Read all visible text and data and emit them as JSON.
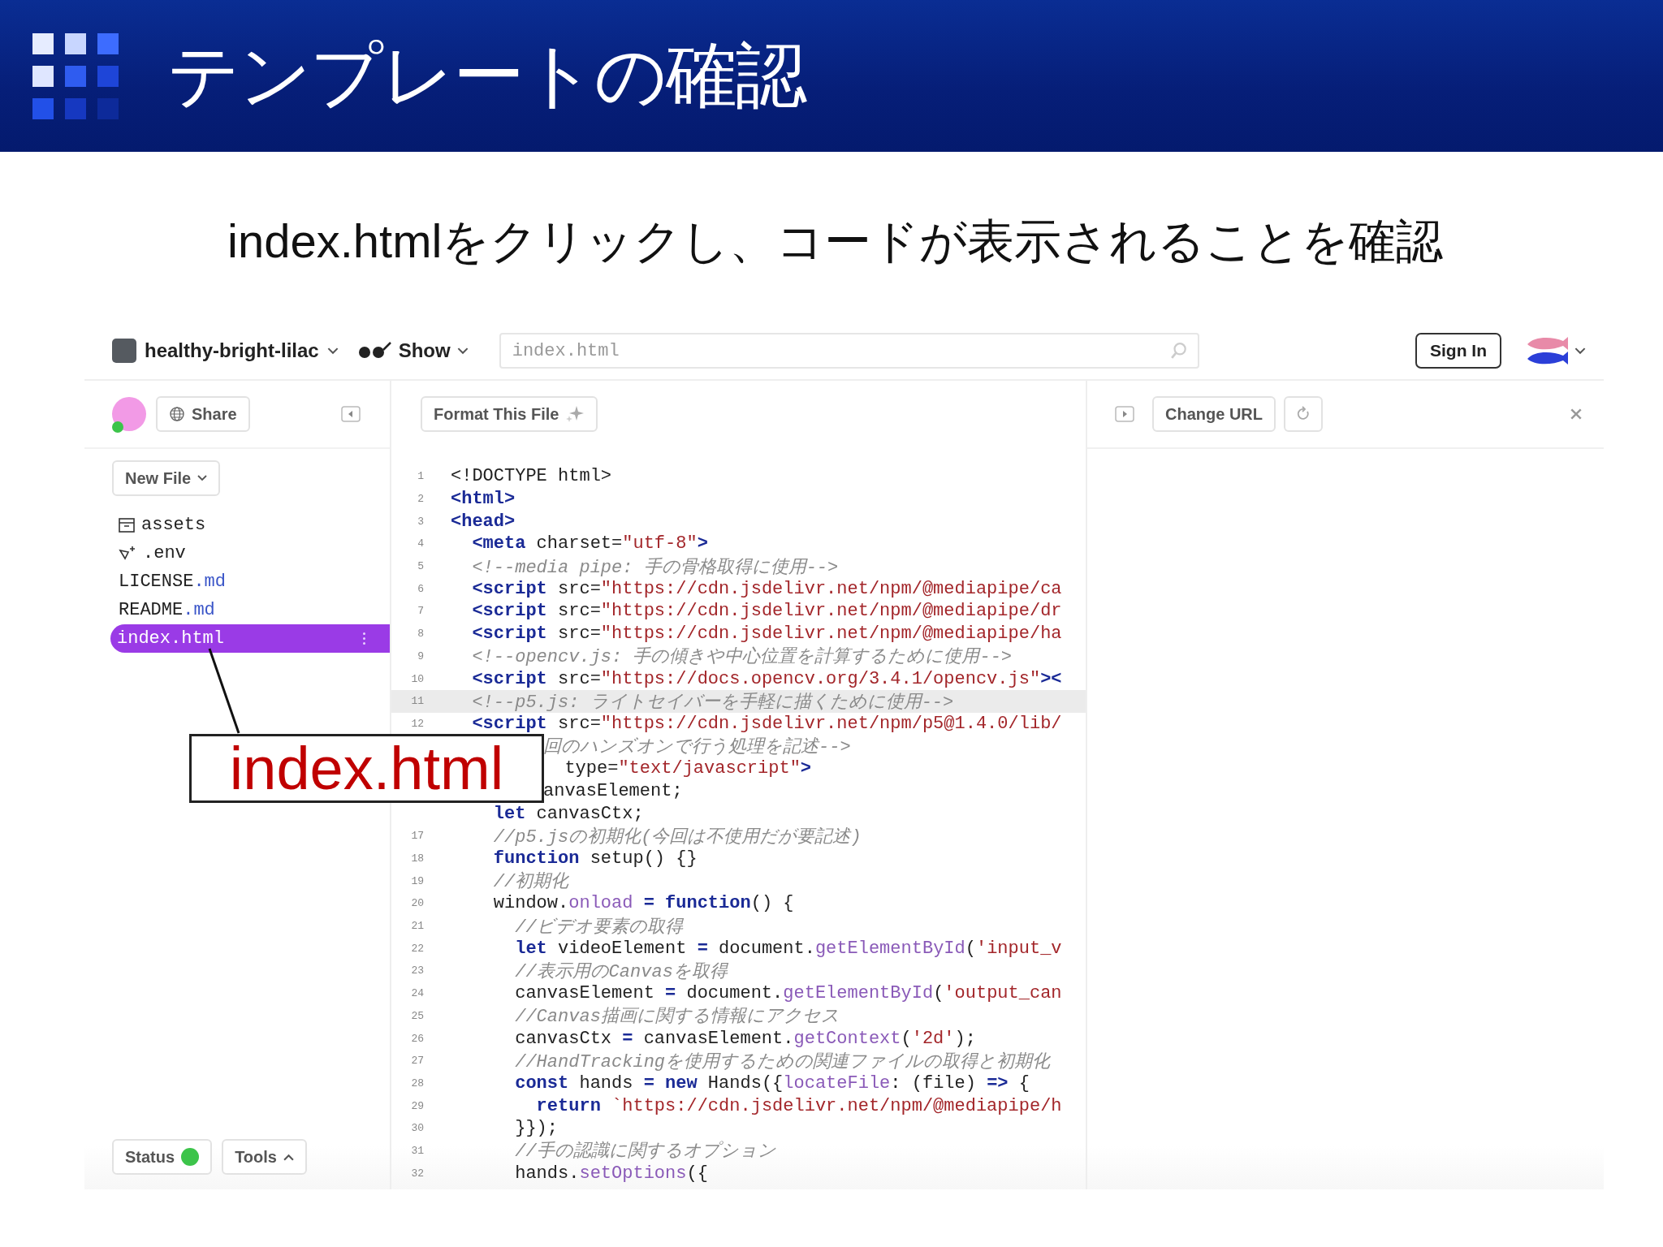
{
  "slide": {
    "title": "テンプレートの確認",
    "subtitle": "index.htmlをクリックし、コードが表示されることを確認"
  },
  "app": {
    "topbar": {
      "project": "healthy-bright-lilac",
      "show": "Show",
      "search_value": "index.html",
      "sign_in": "Sign In"
    },
    "sidebar": {
      "share": "Share",
      "new_file": "New File",
      "files": [
        {
          "kind": "folder",
          "name": "assets",
          "selected": false
        },
        {
          "kind": "secret",
          "name": ".env",
          "selected": false
        },
        {
          "kind": "file",
          "name": "LICENSE",
          "ext": ".md",
          "selected": false
        },
        {
          "kind": "file",
          "name": "README",
          "ext": ".md",
          "selected": false
        },
        {
          "kind": "file",
          "name": "index.html",
          "selected": true
        }
      ],
      "status": "Status",
      "tools": "Tools"
    },
    "editor": {
      "format_button": "Format This File",
      "lines": [
        {
          "kind": "code",
          "number": "1",
          "active": false,
          "tokens": [
            {
              "text": "<!DOCTYPE html>",
              "kind": "plain"
            }
          ]
        },
        {
          "kind": "code",
          "number": "2",
          "active": false,
          "tokens": [
            {
              "text": "<html>",
              "kind": "tag"
            }
          ]
        },
        {
          "kind": "code",
          "number": "3",
          "active": false,
          "tokens": [
            {
              "text": "<head>",
              "kind": "tag"
            }
          ]
        },
        {
          "kind": "code",
          "number": "4",
          "active": false,
          "tokens": [
            {
              "text": "  <meta",
              "kind": "tag"
            },
            {
              "text": " charset=",
              "kind": "plain"
            },
            {
              "text": "\"utf-8\"",
              "kind": "str"
            },
            {
              "text": ">",
              "kind": "tag"
            }
          ]
        },
        {
          "kind": "code",
          "number": "5",
          "active": false,
          "tokens": [
            {
              "text": "  <!--media pipe: 手の骨格取得に使用-->",
              "kind": "com"
            }
          ]
        },
        {
          "kind": "code",
          "number": "6",
          "active": false,
          "tokens": [
            {
              "text": "  <script",
              "kind": "tag"
            },
            {
              "text": " src=",
              "kind": "plain"
            },
            {
              "text": "\"https://cdn.jsdelivr.net/npm/@mediapipe/ca",
              "kind": "str"
            }
          ]
        },
        {
          "kind": "code",
          "number": "7",
          "active": false,
          "tokens": [
            {
              "text": "  <script",
              "kind": "tag"
            },
            {
              "text": " src=",
              "kind": "plain"
            },
            {
              "text": "\"https://cdn.jsdelivr.net/npm/@mediapipe/dr",
              "kind": "str"
            }
          ]
        },
        {
          "kind": "code",
          "number": "8",
          "active": false,
          "tokens": [
            {
              "text": "  <script",
              "kind": "tag"
            },
            {
              "text": " src=",
              "kind": "plain"
            },
            {
              "text": "\"https://cdn.jsdelivr.net/npm/@mediapipe/ha",
              "kind": "str"
            }
          ]
        },
        {
          "kind": "code",
          "number": "9",
          "active": false,
          "tokens": [
            {
              "text": "  <!--opencv.js: 手の傾きや中心位置を計算するために使用-->",
              "kind": "com"
            }
          ]
        },
        {
          "kind": "code",
          "number": "10",
          "active": false,
          "tokens": [
            {
              "text": "  <script",
              "kind": "tag"
            },
            {
              "text": " src=",
              "kind": "plain"
            },
            {
              "text": "\"https://docs.opencv.org/3.4.1/opencv.js\"",
              "kind": "str"
            },
            {
              "text": "><",
              "kind": "tag"
            }
          ]
        },
        {
          "kind": "code",
          "number": "11",
          "active": true,
          "tokens": [
            {
              "text": "  <!--p5.js: ライトセイバーを手軽に描くために使用-->",
              "kind": "com"
            }
          ]
        },
        {
          "kind": "code",
          "number": "12",
          "active": false,
          "tokens": [
            {
              "text": "  <script",
              "kind": "tag"
            },
            {
              "text": " src=",
              "kind": "plain"
            },
            {
              "text": "\"https://cdn.jsdelivr.net/npm/p5@1.4.0/lib/",
              "kind": "str"
            }
          ]
        },
        {
          "kind": "covered",
          "active": false,
          "tokens": [
            {
              "text": "回のハンズオンで行う処理を記述-->",
              "kind": "com"
            }
          ]
        },
        {
          "kind": "covered",
          "active": false,
          "tokens": [
            {
              "text": "  type=",
              "kind": "plain"
            },
            {
              "text": "\"text/javascript\"",
              "kind": "str"
            },
            {
              "text": ">",
              "kind": "tag"
            }
          ]
        },
        {
          "kind": "covered",
          "active": false,
          "tokens": [
            {
              "text": "anvasElement;",
              "kind": "plain"
            }
          ]
        },
        {
          "kind": "unnumbered",
          "active": false,
          "tokens": [
            {
              "text": "    let",
              "kind": "kw"
            },
            {
              "text": " canvasCtx;",
              "kind": "plain"
            }
          ]
        },
        {
          "kind": "code",
          "number": "17",
          "active": false,
          "tokens": [
            {
              "text": "    //p5.jsの初期化(今回は不使用だが要記述)",
              "kind": "com"
            }
          ]
        },
        {
          "kind": "code",
          "number": "18",
          "active": false,
          "tokens": [
            {
              "text": "    function",
              "kind": "kw"
            },
            {
              "text": " setup() {}",
              "kind": "plain"
            }
          ]
        },
        {
          "kind": "code",
          "number": "19",
          "active": false,
          "tokens": [
            {
              "text": "    //初期化",
              "kind": "com"
            }
          ]
        },
        {
          "kind": "code",
          "number": "20",
          "active": false,
          "tokens": [
            {
              "text": "    window.",
              "kind": "plain"
            },
            {
              "text": "onload",
              "kind": "prop"
            },
            {
              "text": " = function",
              "kind": "kw"
            },
            {
              "text": "() {",
              "kind": "plain"
            }
          ]
        },
        {
          "kind": "code",
          "number": "21",
          "active": false,
          "tokens": [
            {
              "text": "      //ビデオ要素の取得",
              "kind": "com"
            }
          ]
        },
        {
          "kind": "code",
          "number": "22",
          "active": false,
          "tokens": [
            {
              "text": "      let",
              "kind": "kw"
            },
            {
              "text": " videoElement ",
              "kind": "plain"
            },
            {
              "text": "=",
              "kind": "kw"
            },
            {
              "text": " document.",
              "kind": "plain"
            },
            {
              "text": "getElementById",
              "kind": "prop"
            },
            {
              "text": "(",
              "kind": "plain"
            },
            {
              "text": "'input_v",
              "kind": "str"
            }
          ]
        },
        {
          "kind": "code",
          "number": "23",
          "active": false,
          "tokens": [
            {
              "text": "      //表示用のCanvasを取得",
              "kind": "com"
            }
          ]
        },
        {
          "kind": "code",
          "number": "24",
          "active": false,
          "tokens": [
            {
              "text": "      canvasElement ",
              "kind": "plain"
            },
            {
              "text": "=",
              "kind": "kw"
            },
            {
              "text": " document.",
              "kind": "plain"
            },
            {
              "text": "getElementById",
              "kind": "prop"
            },
            {
              "text": "(",
              "kind": "plain"
            },
            {
              "text": "'output_can",
              "kind": "str"
            }
          ]
        },
        {
          "kind": "code",
          "number": "25",
          "active": false,
          "tokens": [
            {
              "text": "      //Canvas描画に関する情報にアクセス",
              "kind": "com"
            }
          ]
        },
        {
          "kind": "code",
          "number": "26",
          "active": false,
          "tokens": [
            {
              "text": "      canvasCtx ",
              "kind": "plain"
            },
            {
              "text": "=",
              "kind": "kw"
            },
            {
              "text": " canvasElement.",
              "kind": "plain"
            },
            {
              "text": "getContext",
              "kind": "prop"
            },
            {
              "text": "(",
              "kind": "plain"
            },
            {
              "text": "'2d'",
              "kind": "str"
            },
            {
              "text": ");",
              "kind": "plain"
            }
          ]
        },
        {
          "kind": "code",
          "number": "27",
          "active": false,
          "tokens": [
            {
              "text": "      //HandTrackingを使用するための関連ファイルの取得と初期化",
              "kind": "com"
            }
          ]
        },
        {
          "kind": "code",
          "number": "28",
          "active": false,
          "tokens": [
            {
              "text": "      const",
              "kind": "kw"
            },
            {
              "text": " hands ",
              "kind": "plain"
            },
            {
              "text": "= new",
              "kind": "kw"
            },
            {
              "text": " Hands({",
              "kind": "plain"
            },
            {
              "text": "locateFile",
              "kind": "prop"
            },
            {
              "text": ": (file) ",
              "kind": "plain"
            },
            {
              "text": "=>",
              "kind": "kw"
            },
            {
              "text": " {",
              "kind": "plain"
            }
          ]
        },
        {
          "kind": "code",
          "number": "29",
          "active": false,
          "tokens": [
            {
              "text": "        return",
              "kind": "kw"
            },
            {
              "text": " `https://cdn.jsdelivr.net/npm/@mediapipe/h",
              "kind": "str"
            }
          ]
        },
        {
          "kind": "code",
          "number": "30",
          "active": false,
          "tokens": [
            {
              "text": "      }});",
              "kind": "plain"
            }
          ]
        },
        {
          "kind": "code",
          "number": "31",
          "active": false,
          "tokens": [
            {
              "text": "      //手の認識に関するオプション",
              "kind": "com"
            }
          ]
        },
        {
          "kind": "code",
          "number": "32",
          "active": false,
          "tokens": [
            {
              "text": "      hands.",
              "kind": "plain"
            },
            {
              "text": "setOptions",
              "kind": "prop"
            },
            {
              "text": "({",
              "kind": "plain"
            }
          ]
        }
      ]
    },
    "preview": {
      "change_url": "Change URL"
    }
  },
  "callout": {
    "label": "index.html"
  }
}
